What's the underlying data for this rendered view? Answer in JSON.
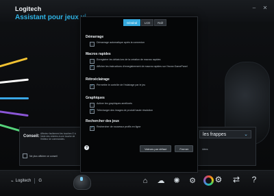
{
  "app": {
    "brand": "Logitech",
    "title": "Assistant pour jeux vi"
  },
  "dialog": {
    "tabs": [
      "Général",
      "LCD",
      "Rafr"
    ],
    "sections": [
      {
        "title": "Démarrage",
        "items": [
          {
            "label": "Démarrage automatique après la connexion",
            "checked": false
          }
        ]
      },
      {
        "title": "Macros rapides",
        "items": [
          {
            "label": "Enregistrer les délais lors de la création de macros rapides",
            "checked": false
          },
          {
            "label": "Afficher les instructions d'enregistrement de macros rapides sur l'écran GamePanel",
            "checked": true
          }
        ]
      },
      {
        "title": "Rétroéclairage",
        "items": [
          {
            "label": "Permettre le contrôle de l'éclairage par le jeu",
            "checked": true
          }
        ]
      },
      {
        "title": "Graphiques",
        "items": [
          {
            "label": "Activer les graphiques améliorés",
            "checked": false
          },
          {
            "label": "Télécharger des images de produit haute résolution",
            "checked": true
          }
        ]
      },
      {
        "title": "Rechercher des jeux",
        "items": [
          {
            "label": "Rechercher de nouveaux profils en ligne",
            "checked": true
          }
        ]
      }
    ],
    "help_label": "?",
    "restore_label": "Valeurs par défaut",
    "close_label": "Fermer"
  },
  "left_panel": {
    "tip_label": "Conseil:",
    "tip_text": "Affectez facilement les touches G à l'aide des entrées à une touche de l'éditeur de commandes.",
    "checkbox_label": "Ne plus afficher ce conseil"
  },
  "right_panel": {
    "dropdown_value": "les frappes",
    "side_note": "idées"
  },
  "footer": {
    "brand": "Logitech",
    "g_mark": "G"
  },
  "colors": {
    "accent": "#36a9dd",
    "app_title": "#2fb4e6"
  }
}
